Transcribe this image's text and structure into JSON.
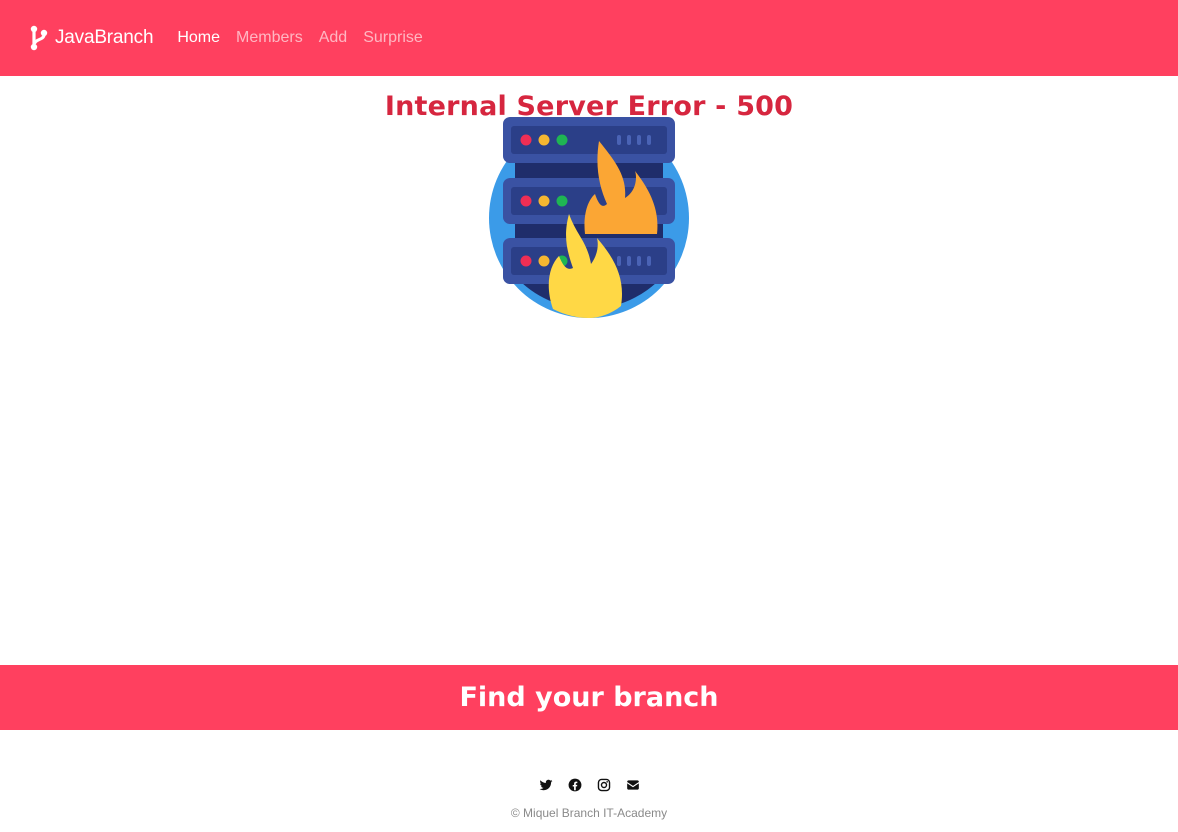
{
  "navbar": {
    "brand": "JavaBranch",
    "links": [
      {
        "label": "Home",
        "active": true
      },
      {
        "label": "Members",
        "active": false
      },
      {
        "label": "Add",
        "active": false
      },
      {
        "label": "Surprise",
        "active": false
      }
    ],
    "background_color": "#ff405f"
  },
  "main": {
    "error_title": "Internal Server Error - 500",
    "title_color": "#d6263f",
    "illustration_icon": "server-on-fire-icon"
  },
  "banner": {
    "text": "Find your branch"
  },
  "footer": {
    "social_icons": [
      "twitter-icon",
      "facebook-icon",
      "instagram-icon",
      "envelope-icon"
    ],
    "copyright": "© Miquel Branch IT-Academy"
  }
}
